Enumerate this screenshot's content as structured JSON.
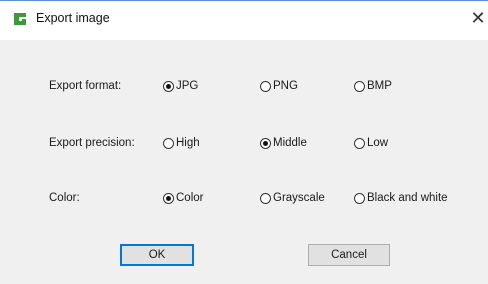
{
  "window": {
    "title": "Export image"
  },
  "icons": {
    "app": "app-logo-icon",
    "close": "close-icon"
  },
  "rows": [
    {
      "label": "Export format:",
      "options": [
        "JPG",
        "PNG",
        "BMP"
      ],
      "selected": "JPG"
    },
    {
      "label": "Export precision:",
      "options": [
        "High",
        "Middle",
        "Low"
      ],
      "selected": "Middle"
    },
    {
      "label": "Color:",
      "options": [
        "Color",
        "Grayscale",
        "Black and white"
      ],
      "selected": "Color"
    }
  ],
  "buttons": {
    "ok": "OK",
    "cancel": "Cancel"
  },
  "colors": {
    "accent": "#0078d7",
    "dialog_bg": "#f0f0f0",
    "logo_green": "#3c9a3c"
  }
}
